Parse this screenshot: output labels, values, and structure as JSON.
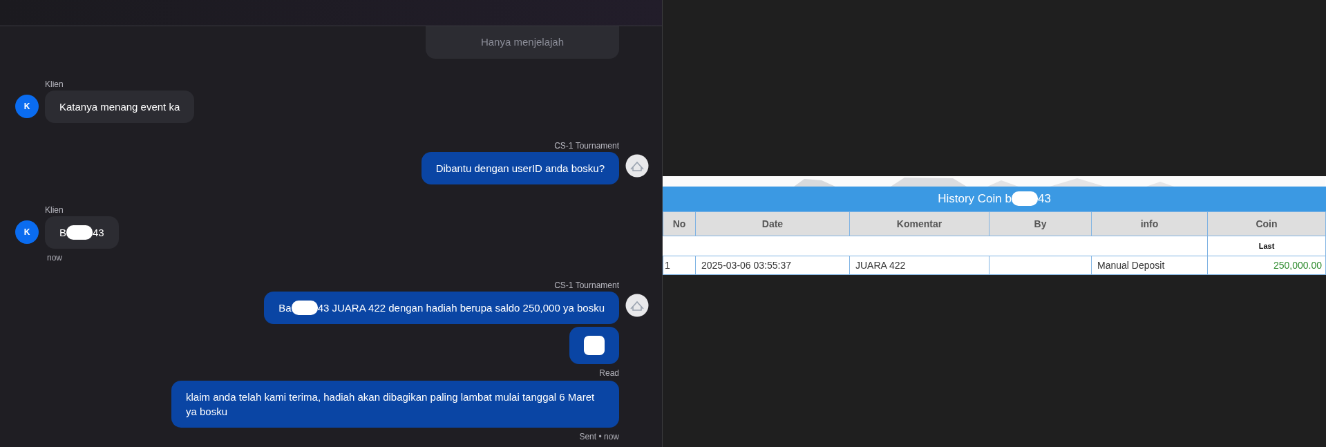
{
  "chat": {
    "messages": [
      {
        "kind": "outgoing",
        "partial": true,
        "parts": [
          {
            "kind": "text",
            "text": "Hanya menjelajah"
          }
        ]
      },
      {
        "kind": "incoming",
        "sender": "Klien",
        "avatar": "K",
        "parts": [
          {
            "kind": "text",
            "text": "Katanya menang event ka"
          }
        ]
      },
      {
        "kind": "outgoing",
        "sender": "CS-1 Tournament",
        "avatar": true,
        "parts": [
          {
            "kind": "text",
            "text": "Dibantu dengan userID anda bosku?"
          }
        ]
      },
      {
        "kind": "incoming",
        "sender": "Klien",
        "avatar": "K",
        "parts": [
          {
            "kind": "text",
            "text": "B"
          },
          {
            "kind": "redaction"
          },
          {
            "kind": "text",
            "text": "43"
          }
        ],
        "status": "now"
      },
      {
        "kind": "outgoing",
        "sender": "CS-1 Tournament",
        "avatar": true,
        "parts": [
          {
            "kind": "text",
            "text": "Ba"
          },
          {
            "kind": "redaction"
          },
          {
            "kind": "text",
            "text": "43 JUARA 422 dengan hadiah berupa saldo 250,000 ya bosku"
          }
        ]
      },
      {
        "kind": "outgoing",
        "parts": [
          {
            "kind": "block"
          }
        ],
        "status": "Read"
      },
      {
        "kind": "outgoing",
        "parts": [
          {
            "kind": "text",
            "text": "klaim anda telah kami terima, hadiah akan dibagikan paling lambat mulai tanggal 6 Maret ya bosku"
          }
        ],
        "status": "Sent • now"
      }
    ]
  },
  "history": {
    "title": [
      {
        "kind": "text",
        "text": "History Coin b"
      },
      {
        "kind": "redaction"
      },
      {
        "kind": "text",
        "text": "43"
      }
    ],
    "columns": [
      {
        "label": "No"
      },
      {
        "label": "Date"
      },
      {
        "label": "Komentar"
      },
      {
        "label": "By"
      },
      {
        "label": "info"
      },
      {
        "label": "Coin",
        "sublabel": "Last",
        "kind": "amount"
      }
    ],
    "rows": [
      {
        "cells": [
          "1",
          "2025-03-06 03:55:37",
          "JUARA 422",
          null,
          "Manual Deposit",
          "250,000.00"
        ]
      }
    ]
  }
}
